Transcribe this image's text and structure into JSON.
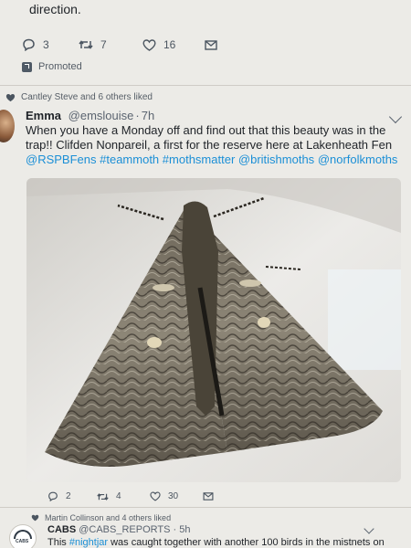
{
  "previous_tweet": {
    "text_tail": "direction.",
    "replies": "3",
    "retweets": "7",
    "likes": "16"
  },
  "promoted_label": "Promoted",
  "liked_banner": "Cantley Steve and 6 others liked",
  "tweet": {
    "name": "Emma",
    "handle": "@emslouise",
    "time": "7h",
    "text_1": "When you have a Monday off and find out that this beauty was in the trap!! Clifden Nonpareil, a first for the reserve here at Lakenheath Fen ",
    "mention_rspb": "@RSPBFens",
    "hashtag_1": "#teammoth",
    "hashtag_2": "#mothsmatter",
    "mention_british": "@britishmoths",
    "mention_norfolk": "@norfolkmoths",
    "replies": "2",
    "retweets": "4",
    "likes": "30"
  },
  "next_liked_banner": "Martin Collinson and 4 others liked",
  "next_tweet": {
    "name": "CABS",
    "handle": "@CABS_REPORTS",
    "time": "5h",
    "logo_text": "CABS",
    "text_start": "This ",
    "hashtag": "#nightjar",
    "text_end": " was caught together with another 100 birds in the mistnets on"
  },
  "colors": {
    "link": "#1b8fd6",
    "icon": "#4b5560",
    "background": "#ecebe7"
  },
  "icons": [
    "reply-icon",
    "retweet-icon",
    "like-icon",
    "message-icon",
    "promoted-icon",
    "chevron-down-icon"
  ]
}
